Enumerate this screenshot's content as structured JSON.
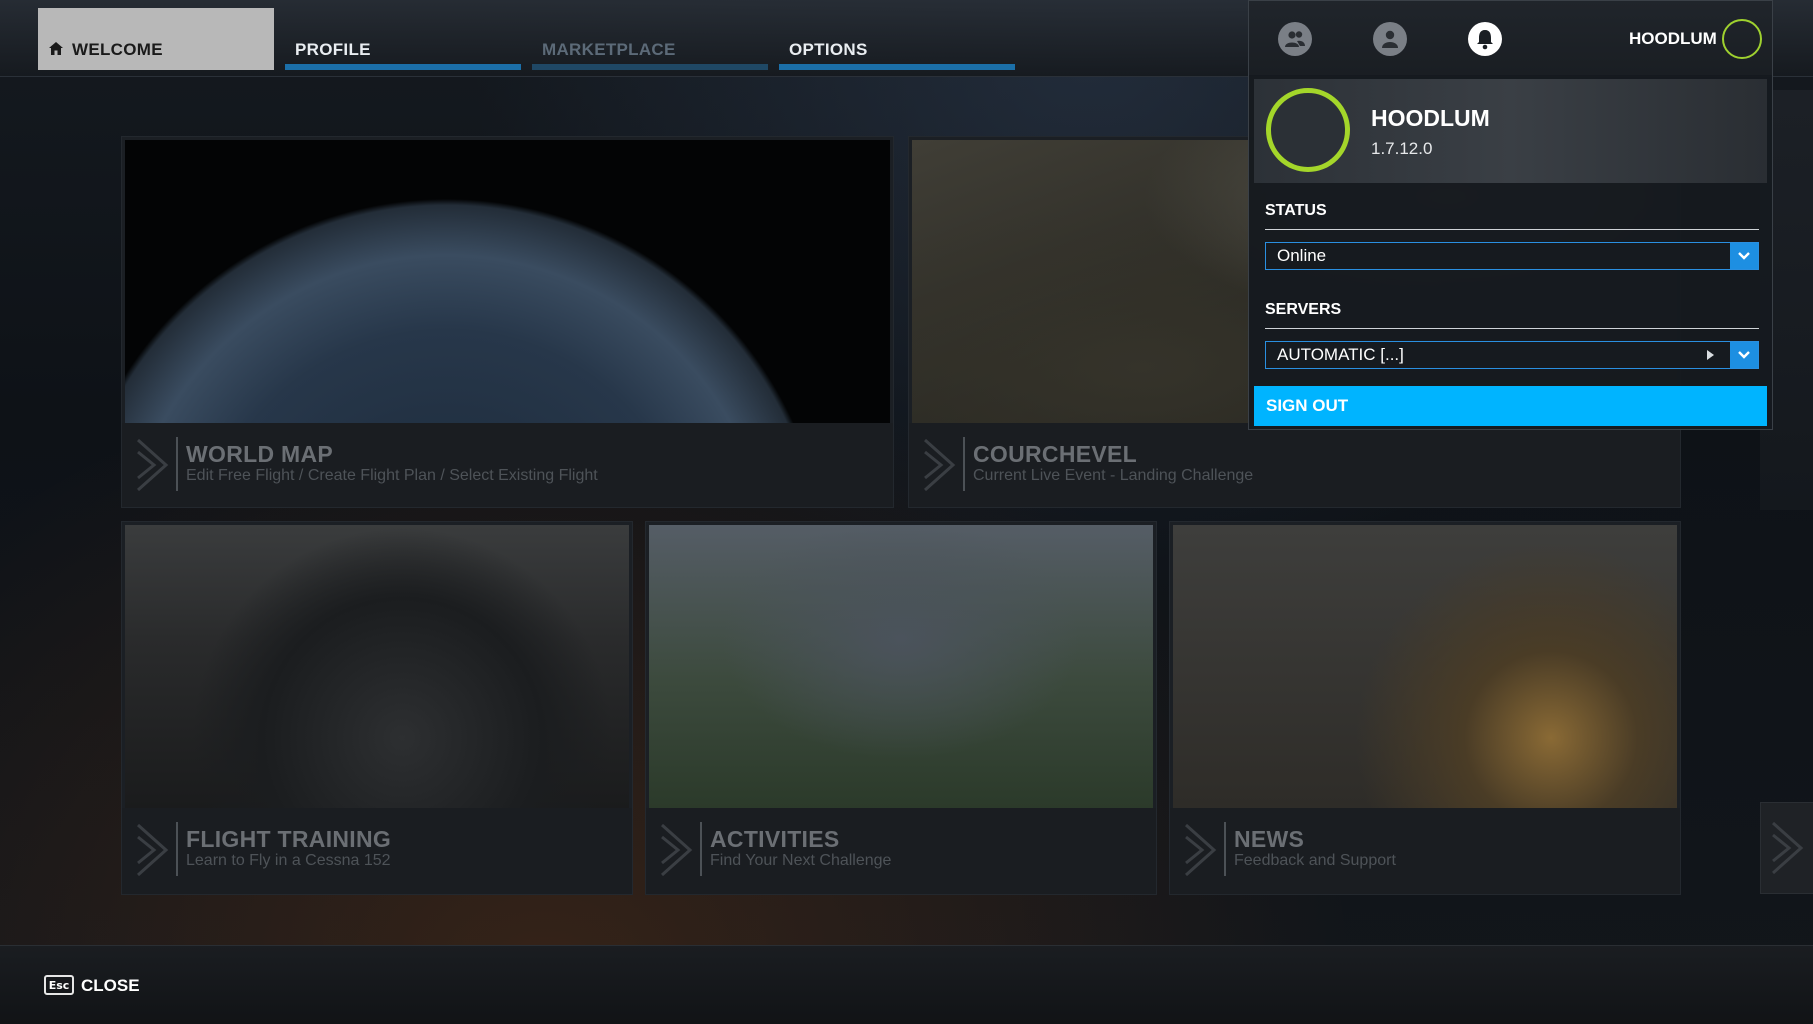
{
  "nav": {
    "tabs": [
      {
        "label": "WELCOME",
        "icon": "home-icon",
        "state": "active"
      },
      {
        "label": "PROFILE",
        "state": "normal"
      },
      {
        "label": "MARKETPLACE",
        "state": "disabled"
      },
      {
        "label": "OPTIONS",
        "state": "normal"
      }
    ]
  },
  "cards": [
    {
      "title": "WORLD MAP",
      "subtitle": "Edit Free Flight / Create Flight Plan / Select Existing Flight"
    },
    {
      "title": "COURCHEVEL",
      "subtitle": "Current Live Event - Landing Challenge"
    },
    {
      "title": "FLIGHT TRAINING",
      "subtitle": "Learn to Fly in a Cessna 152"
    },
    {
      "title": "ACTIVITIES",
      "subtitle": "Find Your Next Challenge"
    },
    {
      "title": "NEWS",
      "subtitle": "Feedback and Support"
    }
  ],
  "bottom": {
    "esc_key": "Esc",
    "close_label": "CLOSE"
  },
  "profile_panel": {
    "toolbar": {
      "icons": [
        "friends-icon",
        "profile-icon",
        "bell-icon"
      ],
      "username": "HOODLUM"
    },
    "header": {
      "username": "HOODLUM",
      "version": "1.7.12.0"
    },
    "status": {
      "label": "STATUS",
      "value": "Online"
    },
    "servers": {
      "label": "SERVERS",
      "value": "AUTOMATIC [...]"
    },
    "sign_out_label": "SIGN OUT"
  },
  "colors": {
    "accent": "#00b4ff",
    "dropdown_arrow": "#1d8fe2",
    "avatar_ring": "#a4d62a",
    "tab_underline": "#1b6fa8"
  }
}
